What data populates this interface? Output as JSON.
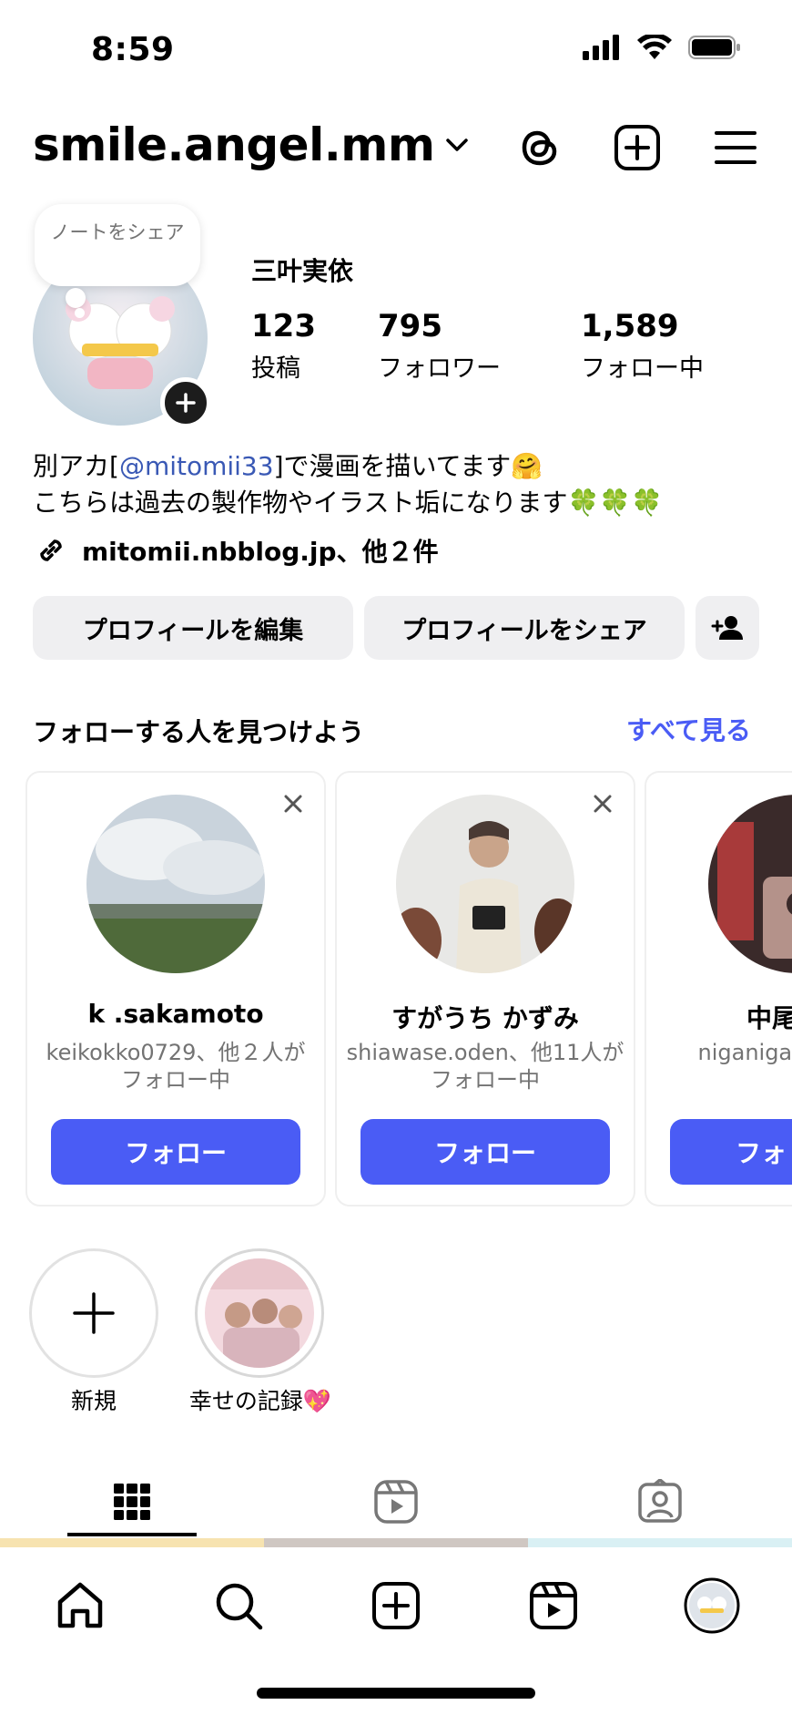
{
  "status_bar": {
    "time": "8:59"
  },
  "header": {
    "username": "smile.angel.mm"
  },
  "profile": {
    "note": "ノートをシェア",
    "full_name": "三叶実依",
    "stats": [
      {
        "value": "123",
        "label": "投稿"
      },
      {
        "value": "795",
        "label": "フォロワー"
      },
      {
        "value": "1,589",
        "label": "フォロー中"
      }
    ],
    "bio_line1_pre": "別アカ[",
    "bio_mention": "@mitomii33",
    "bio_line1_post": "]で漫画を描いてます🤗",
    "bio_line2": "こちらは過去の製作物やイラスト垢になります🍀🍀🍀",
    "link": "mitomii.nbblog.jp、他２件"
  },
  "actions": {
    "edit": "プロフィールを編集",
    "share": "プロフィールをシェア"
  },
  "suggestions": {
    "title": "フォローする人を見つけよう",
    "see_all": "すべて見る",
    "cards": [
      {
        "name": "k .sakamoto",
        "sub": "keikokko0729、他２人がフォロー中",
        "follow": "フォロー"
      },
      {
        "name": "すがうち かずみ",
        "sub": "shiawase.oden、他11人がフォロー中",
        "follow": "フォロー"
      },
      {
        "name": "中尾",
        "sub": "niganigasu がフォ",
        "follow": "フォ"
      }
    ]
  },
  "highlights": [
    {
      "label": "新規"
    },
    {
      "label": "幸せの記録💖"
    }
  ],
  "colors": {
    "accent": "#4a5cf5",
    "mention": "#3a59b5",
    "button_bg": "#efeff1"
  }
}
